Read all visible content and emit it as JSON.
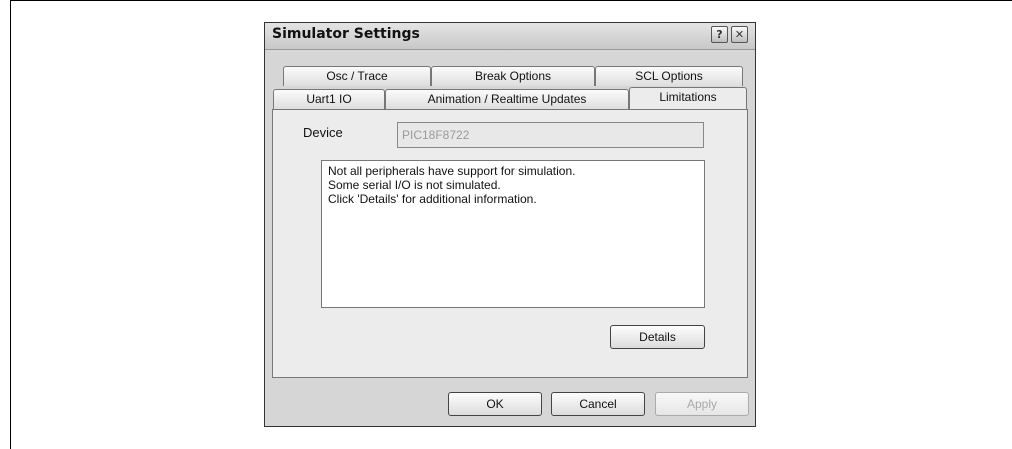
{
  "dialog": {
    "title": "Simulator Settings",
    "help_glyph": "?",
    "close_glyph": "✕"
  },
  "tabs": {
    "row1": [
      "Osc / Trace",
      "Break Options",
      "SCL Options"
    ],
    "row2": [
      "Uart1 IO",
      "Animation / Realtime Updates",
      "Limitations"
    ],
    "active": "Limitations"
  },
  "limitations": {
    "device_label": "Device",
    "device_value": "PIC18F8722",
    "messages": [
      "Not all peripherals have support for simulation.",
      "Some serial I/O is not simulated.",
      "Click 'Details' for additional information."
    ],
    "details_label": "Details"
  },
  "footer": {
    "ok_label": "OK",
    "cancel_label": "Cancel",
    "apply_label": "Apply"
  }
}
